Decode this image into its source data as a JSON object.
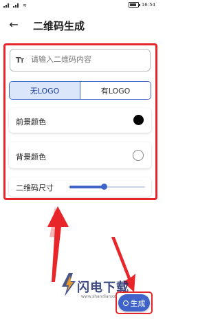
{
  "status_bar": {
    "time": "16:54",
    "battery": ""
  },
  "header": {
    "back_icon": "back-arrow-icon",
    "title": "二维码生成"
  },
  "input": {
    "prefix_icon": "text-format-icon",
    "prefix_glyph": "Tт",
    "placeholder": "请输入二维码内容"
  },
  "logo_toggle": {
    "options": [
      "无LOGO",
      "有LOGO"
    ],
    "selected": "无LOGO"
  },
  "foreground": {
    "label": "前景颜色",
    "color": "#000000"
  },
  "background": {
    "label": "背景颜色",
    "color": "#ffffff"
  },
  "size": {
    "label": "二维码尺寸",
    "value_fraction": 0.45
  },
  "generate": {
    "label": "生成",
    "icon": "generate-icon"
  },
  "colors": {
    "accent": "#3f63c9",
    "highlight": "#e8262a"
  },
  "watermark": {
    "text": "闪电下载",
    "url": "www.shandianxz"
  }
}
